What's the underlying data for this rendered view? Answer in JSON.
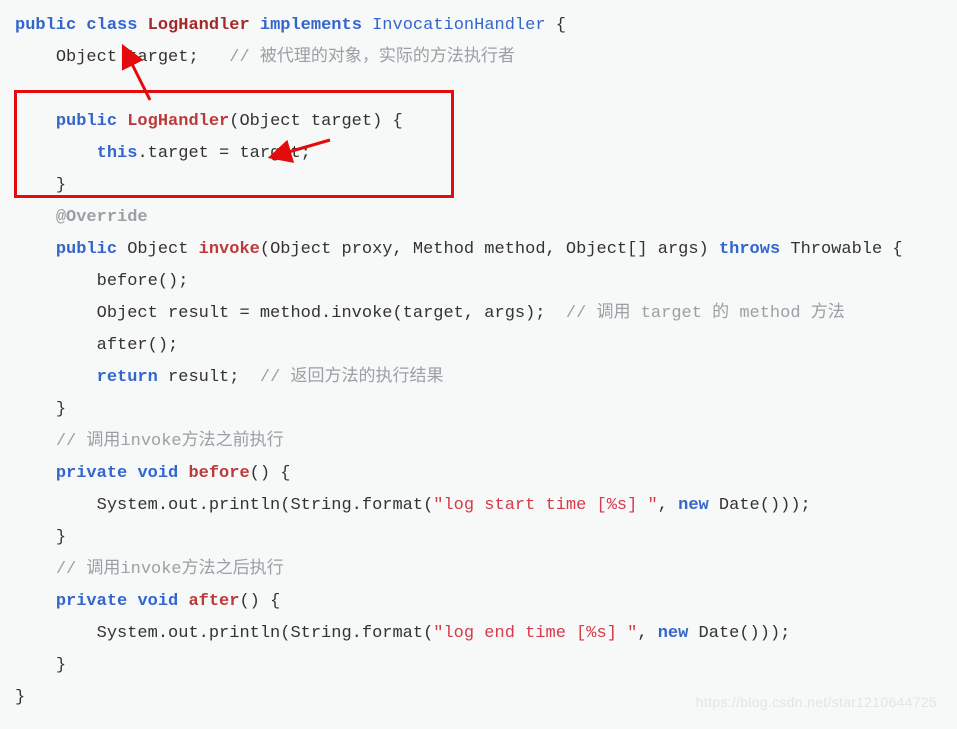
{
  "code": {
    "l1": {
      "kw_public": "public",
      "kw_class": "class",
      "name": "LogHandler",
      "kw_impl": "implements",
      "iface": "InvocationHandler",
      "brace": "{"
    },
    "l2": {
      "type": "Object",
      "field": "target;",
      "cmt": "// 被代理的对象，实际的方法执行者"
    },
    "ctor": {
      "kw": "public",
      "name": "LogHandler",
      "params": "(Object target) {",
      "this_kw": "this",
      "body": ".target = target;",
      "close": "}"
    },
    "over": "@Override",
    "inv": {
      "kw": "public",
      "ret": "Object",
      "name": "invoke",
      "params": "(Object proxy, Method method, Object[] args)",
      "throws_kw": "throws",
      "throwable": "Throwable {",
      "before": "before();",
      "res_l": "Object result = method.invoke(target, args);",
      "res_c": "// 调用 target 的 method 方法",
      "after": "after();",
      "ret_kw": "return",
      "ret_v": "result;",
      "ret_c": "// 返回方法的执行结果",
      "close": "}"
    },
    "c_before": "// 调用invoke方法之前执行",
    "bef": {
      "kw": "private",
      "void": "void",
      "name": "before",
      "params": "() {",
      "body_l": "System.out.println(String.format(",
      "str": "\"log start time [%s] \"",
      "body_m": ", ",
      "new_kw": "new",
      "body_r": " Date()));",
      "close": "}"
    },
    "c_after": "// 调用invoke方法之后执行",
    "aft": {
      "kw": "private",
      "void": "void",
      "name": "after",
      "params": "() {",
      "body_l": "System.out.println(String.format(",
      "str": "\"log end time [%s] \"",
      "body_m": ", ",
      "new_kw": "new",
      "body_r": " Date()));",
      "close": "}"
    },
    "end": "}"
  },
  "watermark": "https://blog.csdn.net/star1210644725"
}
